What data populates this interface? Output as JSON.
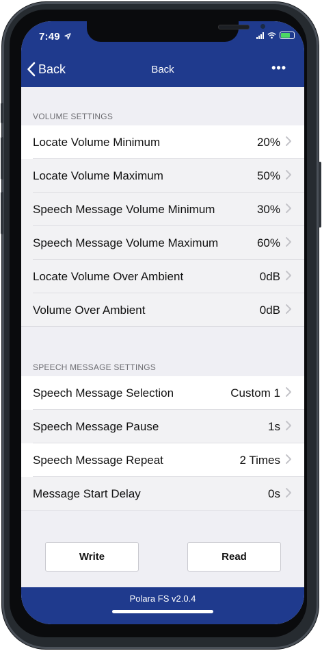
{
  "status": {
    "time": "7:49"
  },
  "nav": {
    "back_label": "Back",
    "title": "Back",
    "more_label": "•••"
  },
  "volume_settings": {
    "header": "VOLUME SETTINGS",
    "rows": [
      {
        "label": "Locate Volume Minimum",
        "value": "20%"
      },
      {
        "label": "Locate Volume Maximum",
        "value": "50%"
      },
      {
        "label": "Speech Message Volume Minimum",
        "value": "30%"
      },
      {
        "label": "Speech Message Volume Maximum",
        "value": "60%"
      },
      {
        "label": "Locate Volume Over Ambient",
        "value": "0dB"
      },
      {
        "label": "Volume Over Ambient",
        "value": "0dB"
      }
    ]
  },
  "speech_settings": {
    "header": "SPEECH MESSAGE SETTINGS",
    "rows": [
      {
        "label": "Speech Message Selection",
        "value": "Custom 1"
      },
      {
        "label": "Speech Message Pause",
        "value": "1s"
      },
      {
        "label": "Speech Message Repeat",
        "value": "2 Times"
      },
      {
        "label": "Message Start Delay",
        "value": "0s"
      }
    ]
  },
  "actions": {
    "write_label": "Write",
    "read_label": "Read"
  },
  "footer": {
    "version": "Polara FS v2.0.4"
  },
  "colors": {
    "brand": "#1f3a8d",
    "battery": "#4cd964",
    "background": "#efeff4"
  },
  "icons": {
    "back": "chevron-left-icon",
    "more": "ellipsis-icon",
    "row_disclosure": "chevron-right-icon",
    "location": "location-arrow-icon",
    "signal": "cellular-signal-icon",
    "wifi": "wifi-icon",
    "battery": "battery-icon"
  }
}
